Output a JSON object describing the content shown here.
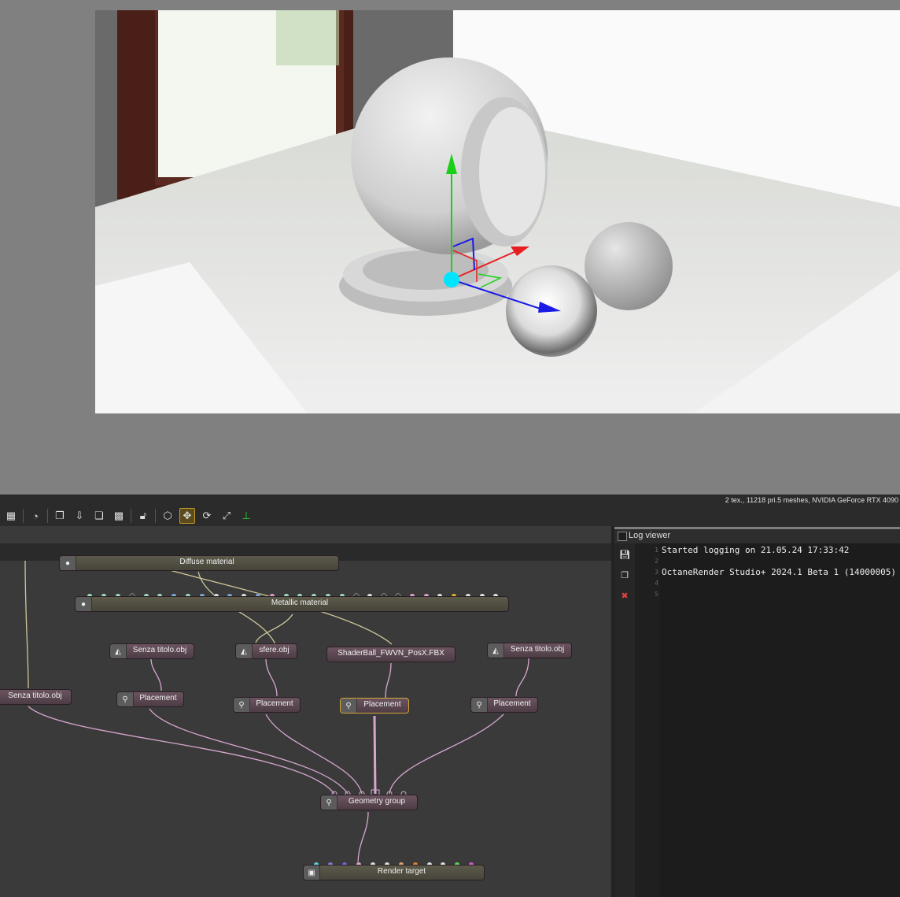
{
  "toolbar": {
    "stats": "2 tex., 11218 pri.5 meshes, NVIDIA GeForce RTX 4090",
    "icons": [
      "render-mode-icon",
      "speed-icon",
      "copy-icon",
      "import-icon",
      "layers-icon",
      "checker-icon",
      "lock-icon",
      "box-icon",
      "move-icon",
      "rotate-icon",
      "fit-icon",
      "axis-icon"
    ]
  },
  "nodes": {
    "diffuse": "Diffuse material",
    "metallic": "Metallic material",
    "senza1": "Senza titolo.obj",
    "sfere": "sfere.obj",
    "shaderball": "ShaderBall_FWVN_PosX.FBX",
    "senza2": "Senza titolo.obj",
    "senza_left": "Senza titolo.obj",
    "placement1": "Placement",
    "placement2": "Placement",
    "placement3": "Placement",
    "placement4": "Placement",
    "geometry_group": "Geometry group",
    "render_target": "Render target"
  },
  "log": {
    "title": "Log viewer",
    "lines": [
      {
        "num": "1",
        "text": "Started logging on 21.05.24 17:33:42"
      },
      {
        "num": "2",
        "text": ""
      },
      {
        "num": "3",
        "text": "OctaneRender Studio+ 2024.1 Beta 1 (14000005)"
      },
      {
        "num": "4",
        "text": ""
      },
      {
        "num": "5",
        "text": ""
      }
    ]
  },
  "colors": {
    "accent": "#c89b2a",
    "wire_geometry": "#d7a6cf",
    "wire_material": "#cfc79a",
    "gizmo_center": "#00e5ff"
  }
}
